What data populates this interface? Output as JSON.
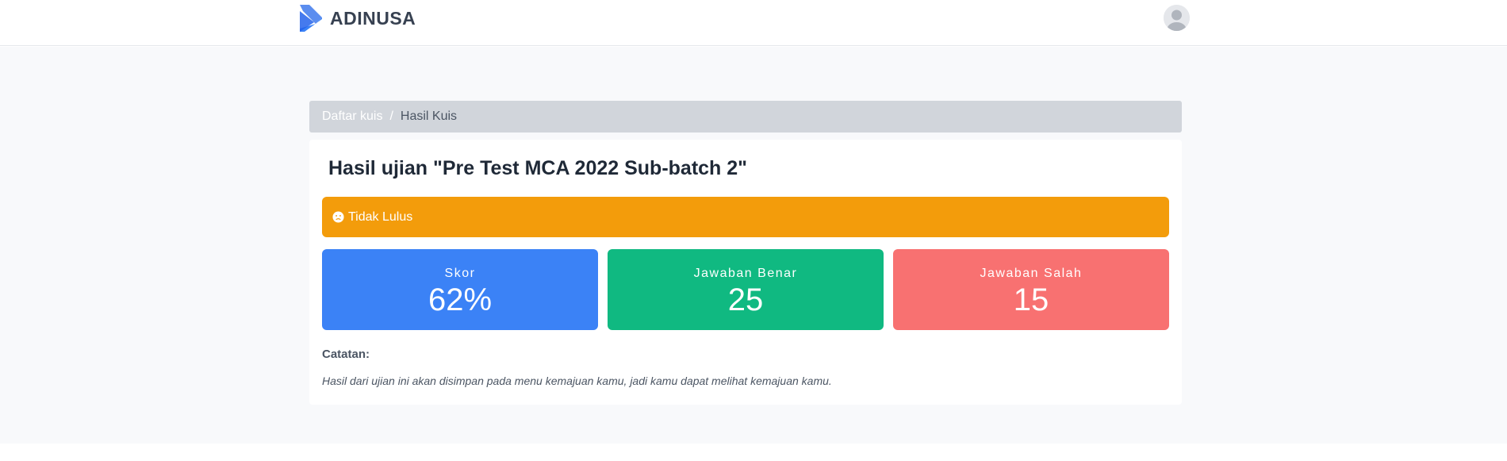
{
  "brand": {
    "name": "ADINUSA",
    "logo_icon": "chevron-logo-icon",
    "color": "#3b82f6"
  },
  "user": {
    "avatar_icon": "user-avatar-icon"
  },
  "breadcrumb": {
    "link": "Daftar kuis",
    "separator": "/",
    "current": "Hasil Kuis"
  },
  "result": {
    "title": "Hasil ujian \"Pre Test MCA 2022 Sub-batch 2\"",
    "status": {
      "label": "Tidak Lulus",
      "icon": "sad-face-icon",
      "color": "#f39c0b"
    },
    "stats": [
      {
        "label": "Skor",
        "value": "62%",
        "color": "#3b82f6"
      },
      {
        "label": "Jawaban Benar",
        "value": "25",
        "color": "#10b981"
      },
      {
        "label": "Jawaban Salah",
        "value": "15",
        "color": "#f87171"
      }
    ],
    "notes": {
      "label": "Catatan:",
      "text": "Hasil dari ujian ini akan disimpan pada menu kemajuan kamu, jadi kamu dapat melihat kemajuan kamu."
    }
  }
}
